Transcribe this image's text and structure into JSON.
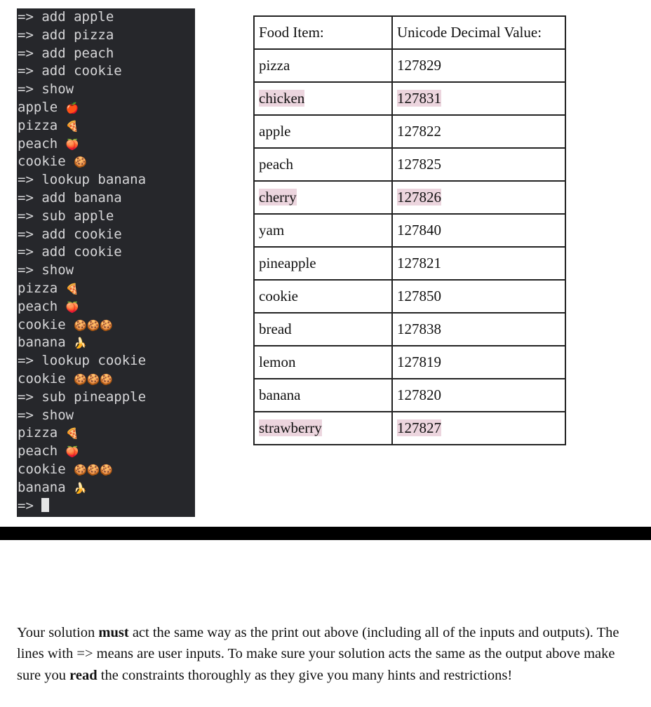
{
  "terminal": {
    "lines": [
      {
        "text": "=> add apple",
        "emoji": ""
      },
      {
        "text": "=> add pizza",
        "emoji": ""
      },
      {
        "text": "=> add peach",
        "emoji": ""
      },
      {
        "text": "=> add cookie",
        "emoji": ""
      },
      {
        "text": "=> show",
        "emoji": ""
      },
      {
        "text": "apple ",
        "emoji": "🍎"
      },
      {
        "text": "pizza ",
        "emoji": "🍕"
      },
      {
        "text": "peach ",
        "emoji": "🍑"
      },
      {
        "text": "cookie ",
        "emoji": "🍪"
      },
      {
        "text": "=> lookup banana",
        "emoji": ""
      },
      {
        "text": "=> add banana",
        "emoji": ""
      },
      {
        "text": "=> sub apple",
        "emoji": ""
      },
      {
        "text": "=> add cookie",
        "emoji": ""
      },
      {
        "text": "=> add cookie",
        "emoji": ""
      },
      {
        "text": "=> show",
        "emoji": ""
      },
      {
        "text": "pizza ",
        "emoji": "🍕"
      },
      {
        "text": "peach ",
        "emoji": "🍑"
      },
      {
        "text": "cookie ",
        "emoji": "🍪🍪🍪"
      },
      {
        "text": "banana ",
        "emoji": "🍌"
      },
      {
        "text": "=> lookup cookie",
        "emoji": ""
      },
      {
        "text": "cookie ",
        "emoji": "🍪🍪🍪"
      },
      {
        "text": "=> sub pineapple",
        "emoji": ""
      },
      {
        "text": "=> show",
        "emoji": ""
      },
      {
        "text": "pizza ",
        "emoji": "🍕"
      },
      {
        "text": "peach ",
        "emoji": "🍑"
      },
      {
        "text": "cookie ",
        "emoji": "🍪🍪🍪"
      },
      {
        "text": "banana ",
        "emoji": "🍌"
      }
    ],
    "prompt": "=> "
  },
  "table": {
    "headers": [
      "Food Item:",
      "Unicode Decimal Value:"
    ],
    "rows": [
      {
        "item": "pizza",
        "value": "127829",
        "highlighted": false
      },
      {
        "item": "chicken",
        "value": "127831",
        "highlighted": true
      },
      {
        "item": "apple",
        "value": "127822",
        "highlighted": false
      },
      {
        "item": "peach",
        "value": "127825",
        "highlighted": false
      },
      {
        "item": "cherry",
        "value": "127826",
        "highlighted": true
      },
      {
        "item": "yam",
        "value": "127840",
        "highlighted": false
      },
      {
        "item": "pineapple",
        "value": "127821",
        "highlighted": false
      },
      {
        "item": "cookie",
        "value": "127850",
        "highlighted": false
      },
      {
        "item": "bread",
        "value": "127838",
        "highlighted": false
      },
      {
        "item": "lemon",
        "value": "127819",
        "highlighted": false
      },
      {
        "item": "banana",
        "value": "127820",
        "highlighted": false
      },
      {
        "item": "strawberry",
        "value": "127827",
        "highlighted": true
      }
    ],
    "highlight_color": "#ecd5de"
  },
  "paragraph": {
    "p1": "Your solution ",
    "b1": "must",
    "p2": " act the same way as the print out above (including all of the inputs and outputs). The lines with => means are user inputs. To make sure your solution acts the same as the output above make sure you ",
    "b2": "read",
    "p3": " the constraints thoroughly as they give you many hints and restrictions!"
  }
}
